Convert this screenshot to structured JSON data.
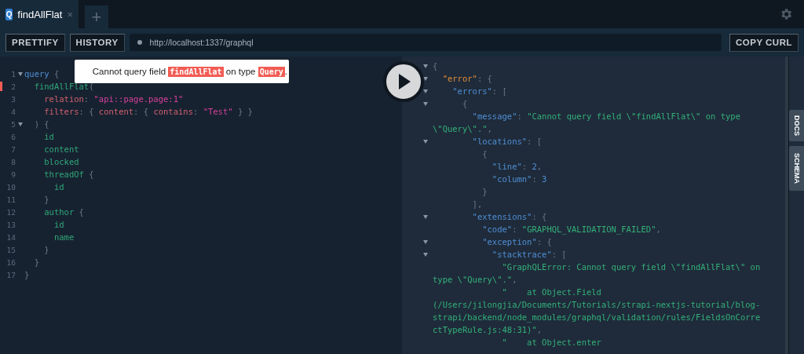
{
  "tabs": [
    {
      "badge": "Q",
      "title": "findAllFlat",
      "close": "×",
      "selected": true
    }
  ],
  "new_tab": "+",
  "toolbar": {
    "buttons": [
      "PRETTIFY",
      "HISTORY"
    ],
    "url": "http://localhost:1337/graphql",
    "copy_button": "COPY CURL"
  },
  "error_tooltip": {
    "parts": [
      {
        "text": "Cannot query field ",
        "kind": "plain"
      },
      {
        "text": "findAllFlat",
        "kind": "code"
      },
      {
        "text": " on type ",
        "kind": "plain"
      },
      {
        "text": "Query",
        "kind": "code"
      },
      {
        "text": ".",
        "kind": "plain"
      }
    ]
  },
  "editor": {
    "lines": [
      {
        "number": "1",
        "foldable": true,
        "error": false,
        "tokens": [
          {
            "text": "query",
            "kind": "keyword"
          },
          {
            "text": " {",
            "kind": "punct"
          }
        ]
      },
      {
        "number": "2",
        "foldable": false,
        "error": true,
        "tokens": [
          {
            "text": "  findAllFlat",
            "kind": "field"
          },
          {
            "text": "(",
            "kind": "punct"
          }
        ]
      },
      {
        "number": "3",
        "foldable": false,
        "error": false,
        "tokens": [
          {
            "text": "    relation",
            "kind": "arg"
          },
          {
            "text": ": ",
            "kind": "punct"
          },
          {
            "text": "\"api::page.page:1\"",
            "kind": "string"
          }
        ]
      },
      {
        "number": "4",
        "foldable": false,
        "error": false,
        "tokens": [
          {
            "text": "    filters",
            "kind": "arg"
          },
          {
            "text": ": { ",
            "kind": "punct"
          },
          {
            "text": "content",
            "kind": "arg"
          },
          {
            "text": ": { ",
            "kind": "punct"
          },
          {
            "text": "contains",
            "kind": "arg"
          },
          {
            "text": ": ",
            "kind": "punct"
          },
          {
            "text": "\"Test\"",
            "kind": "string"
          },
          {
            "text": " } }",
            "kind": "punct"
          }
        ]
      },
      {
        "number": "5",
        "foldable": true,
        "error": false,
        "tokens": [
          {
            "text": "  ) {",
            "kind": "punct"
          }
        ]
      },
      {
        "number": "6",
        "foldable": false,
        "error": false,
        "tokens": [
          {
            "text": "    id",
            "kind": "field"
          }
        ]
      },
      {
        "number": "7",
        "foldable": false,
        "error": false,
        "tokens": [
          {
            "text": "    content",
            "kind": "field"
          }
        ]
      },
      {
        "number": "8",
        "foldable": false,
        "error": false,
        "tokens": [
          {
            "text": "    blocked",
            "kind": "field"
          }
        ]
      },
      {
        "number": "9",
        "foldable": false,
        "error": false,
        "tokens": [
          {
            "text": "    threadOf",
            "kind": "field"
          },
          {
            "text": " {",
            "kind": "punct"
          }
        ]
      },
      {
        "number": "10",
        "foldable": false,
        "error": false,
        "tokens": [
          {
            "text": "      id",
            "kind": "field"
          }
        ]
      },
      {
        "number": "11",
        "foldable": false,
        "error": false,
        "tokens": [
          {
            "text": "    }",
            "kind": "punct"
          }
        ]
      },
      {
        "number": "12",
        "foldable": false,
        "error": false,
        "tokens": [
          {
            "text": "    author",
            "kind": "field"
          },
          {
            "text": " {",
            "kind": "punct"
          }
        ]
      },
      {
        "number": "13",
        "foldable": false,
        "error": false,
        "tokens": [
          {
            "text": "      id",
            "kind": "field"
          }
        ]
      },
      {
        "number": "14",
        "foldable": false,
        "error": false,
        "tokens": [
          {
            "text": "      name",
            "kind": "field"
          }
        ]
      },
      {
        "number": "15",
        "foldable": false,
        "error": false,
        "tokens": [
          {
            "text": "    }",
            "kind": "punct"
          }
        ]
      },
      {
        "number": "16",
        "foldable": false,
        "error": false,
        "tokens": [
          {
            "text": "  }",
            "kind": "punct"
          }
        ]
      },
      {
        "number": "17",
        "foldable": false,
        "error": false,
        "tokens": [
          {
            "text": "}",
            "kind": "punct"
          }
        ]
      }
    ]
  },
  "result": {
    "lines": [
      {
        "foldable": true,
        "tokens": [
          {
            "text": "{",
            "kind": "punct"
          }
        ]
      },
      {
        "foldable": true,
        "tokens": [
          {
            "text": "  \"error\"",
            "kind": "errkey"
          },
          {
            "text": ": {",
            "kind": "punct"
          }
        ]
      },
      {
        "foldable": true,
        "tokens": [
          {
            "text": "    \"errors\"",
            "kind": "key"
          },
          {
            "text": ": [",
            "kind": "punct"
          }
        ]
      },
      {
        "foldable": true,
        "tokens": [
          {
            "text": "      {",
            "kind": "punct"
          }
        ]
      },
      {
        "foldable": false,
        "tokens": [
          {
            "text": "        \"message\"",
            "kind": "key"
          },
          {
            "text": ": ",
            "kind": "punct"
          },
          {
            "text": "\"Cannot query field \\\"findAllFlat\\\" on type",
            "kind": "string"
          }
        ]
      },
      {
        "foldable": false,
        "tokens": [
          {
            "text": "\\\"Query\\\".\"",
            "kind": "string"
          },
          {
            "text": ",",
            "kind": "punct"
          }
        ]
      },
      {
        "foldable": true,
        "tokens": [
          {
            "text": "        \"locations\"",
            "kind": "key"
          },
          {
            "text": ": [",
            "kind": "punct"
          }
        ]
      },
      {
        "foldable": false,
        "tokens": [
          {
            "text": "          {",
            "kind": "punct"
          }
        ]
      },
      {
        "foldable": false,
        "tokens": [
          {
            "text": "            \"line\"",
            "kind": "key"
          },
          {
            "text": ": ",
            "kind": "punct"
          },
          {
            "text": "2",
            "kind": "number"
          },
          {
            "text": ",",
            "kind": "punct"
          }
        ]
      },
      {
        "foldable": false,
        "tokens": [
          {
            "text": "            \"column\"",
            "kind": "key"
          },
          {
            "text": ": ",
            "kind": "punct"
          },
          {
            "text": "3",
            "kind": "number"
          }
        ]
      },
      {
        "foldable": false,
        "tokens": [
          {
            "text": "          }",
            "kind": "punct"
          }
        ]
      },
      {
        "foldable": false,
        "tokens": [
          {
            "text": "        ],",
            "kind": "punct"
          }
        ]
      },
      {
        "foldable": true,
        "tokens": [
          {
            "text": "        \"extensions\"",
            "kind": "key"
          },
          {
            "text": ": {",
            "kind": "punct"
          }
        ]
      },
      {
        "foldable": false,
        "tokens": [
          {
            "text": "          \"code\"",
            "kind": "key"
          },
          {
            "text": ": ",
            "kind": "punct"
          },
          {
            "text": "\"GRAPHQL_VALIDATION_FAILED\"",
            "kind": "string"
          },
          {
            "text": ",",
            "kind": "punct"
          }
        ]
      },
      {
        "foldable": true,
        "tokens": [
          {
            "text": "          \"exception\"",
            "kind": "key"
          },
          {
            "text": ": {",
            "kind": "punct"
          }
        ]
      },
      {
        "foldable": true,
        "tokens": [
          {
            "text": "            \"stacktrace\"",
            "kind": "key"
          },
          {
            "text": ": [",
            "kind": "punct"
          }
        ]
      },
      {
        "foldable": false,
        "tokens": [
          {
            "text": "              \"GraphQLError: Cannot query field \\\"findAllFlat\\\" on",
            "kind": "string"
          }
        ]
      },
      {
        "foldable": false,
        "tokens": [
          {
            "text": "type \\\"Query\\\".\"",
            "kind": "string"
          },
          {
            "text": ",",
            "kind": "punct"
          }
        ]
      },
      {
        "foldable": false,
        "tokens": [
          {
            "text": "              \"    at Object.Field",
            "kind": "string"
          }
        ]
      },
      {
        "foldable": false,
        "tokens": [
          {
            "text": "(/Users/jilongjia/Documents/Tutorials/strapi-nextjs-tutorial/blog-",
            "kind": "string"
          }
        ]
      },
      {
        "foldable": false,
        "tokens": [
          {
            "text": "strapi/backend/node_modules/graphql/validation/rules/FieldsOnCorre",
            "kind": "string"
          }
        ]
      },
      {
        "foldable": false,
        "tokens": [
          {
            "text": "ctTypeRule.js:48:31)\"",
            "kind": "string"
          },
          {
            "text": ",",
            "kind": "punct"
          }
        ]
      },
      {
        "foldable": false,
        "tokens": [
          {
            "text": "              \"    at Object.enter",
            "kind": "string"
          }
        ]
      }
    ]
  },
  "side_tabs": [
    "DOCS",
    "SCHEMA"
  ]
}
